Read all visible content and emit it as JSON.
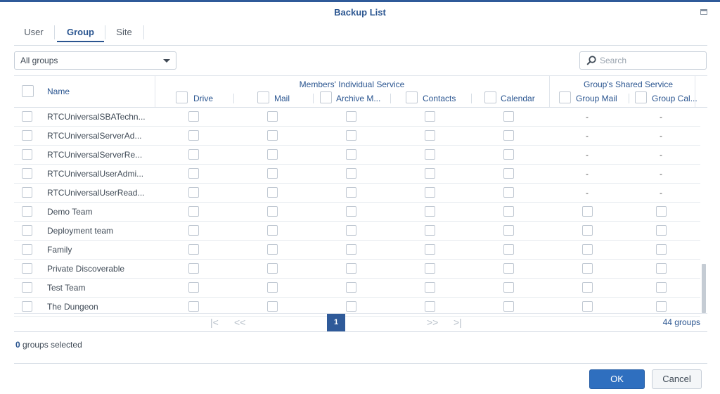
{
  "window": {
    "title": "Backup List"
  },
  "tabs": [
    {
      "label": "User",
      "active": false
    },
    {
      "label": "Group",
      "active": true
    },
    {
      "label": "Site",
      "active": false
    }
  ],
  "filter": {
    "selected": "All groups"
  },
  "search": {
    "placeholder": "Search",
    "value": ""
  },
  "table": {
    "name_header": "Name",
    "members_group_title": "Members' Individual Service",
    "shared_group_title": "Group's Shared Service",
    "member_columns": [
      "Drive",
      "Mail",
      "Archive M...",
      "Contacts",
      "Calendar"
    ],
    "shared_columns": [
      "Group Mail",
      "Group Cal..."
    ],
    "rows": [
      {
        "name": "RTCUniversalSBATechn...",
        "shared": "dash"
      },
      {
        "name": "RTCUniversalServerAd...",
        "shared": "dash"
      },
      {
        "name": "RTCUniversalServerRe...",
        "shared": "dash"
      },
      {
        "name": "RTCUniversalUserAdmi...",
        "shared": "dash"
      },
      {
        "name": "RTCUniversalUserRead...",
        "shared": "dash"
      },
      {
        "name": "Demo Team",
        "shared": "checkbox"
      },
      {
        "name": "Deployment team",
        "shared": "checkbox"
      },
      {
        "name": "Family",
        "shared": "checkbox"
      },
      {
        "name": "Private Discoverable",
        "shared": "checkbox"
      },
      {
        "name": "Test Team",
        "shared": "checkbox"
      },
      {
        "name": "The Dungeon",
        "shared": "checkbox"
      }
    ],
    "dash_text": "-"
  },
  "pager": {
    "first": "|<",
    "prev": "<<",
    "current_page": "1",
    "next": ">>",
    "last": ">|",
    "count_text": "44 groups"
  },
  "selection": {
    "count": "0",
    "suffix": " groups selected"
  },
  "buttons": {
    "ok": "OK",
    "cancel": "Cancel"
  },
  "colors": {
    "accent": "#2a5590",
    "primary_button": "#2f6fbf",
    "top_bar": "#2f5a99"
  }
}
